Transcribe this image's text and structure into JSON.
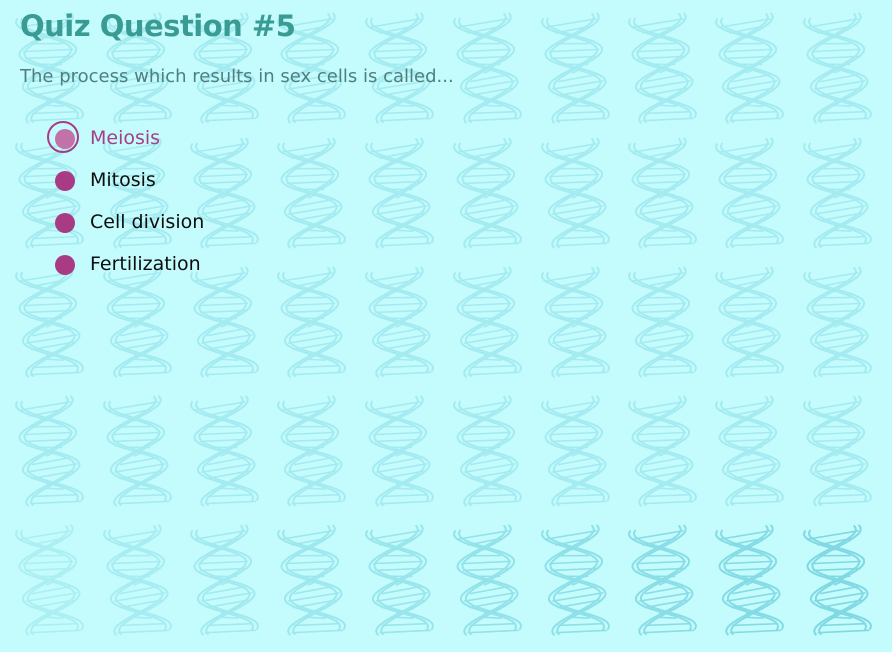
{
  "quiz": {
    "title": "Quiz Question #5",
    "question": "The process which results in sex cells is called...",
    "options": [
      {
        "label": "Meiosis",
        "selected": true
      },
      {
        "label": "Mitosis",
        "selected": false
      },
      {
        "label": "Cell division",
        "selected": false
      },
      {
        "label": "Fertilization",
        "selected": false
      }
    ]
  },
  "theme": {
    "background": "#c4fcfd",
    "title_color": "#3a9a94",
    "question_color": "#4f7e7e",
    "option_text": "#0d0d0d",
    "selected_text": "#a33f86",
    "radio_fill": "#a93b84",
    "radio_selected_fill": "#c272a8",
    "helix_color": "#7fd8e3"
  },
  "background_pattern": {
    "icon": "dna-helix-icon"
  }
}
